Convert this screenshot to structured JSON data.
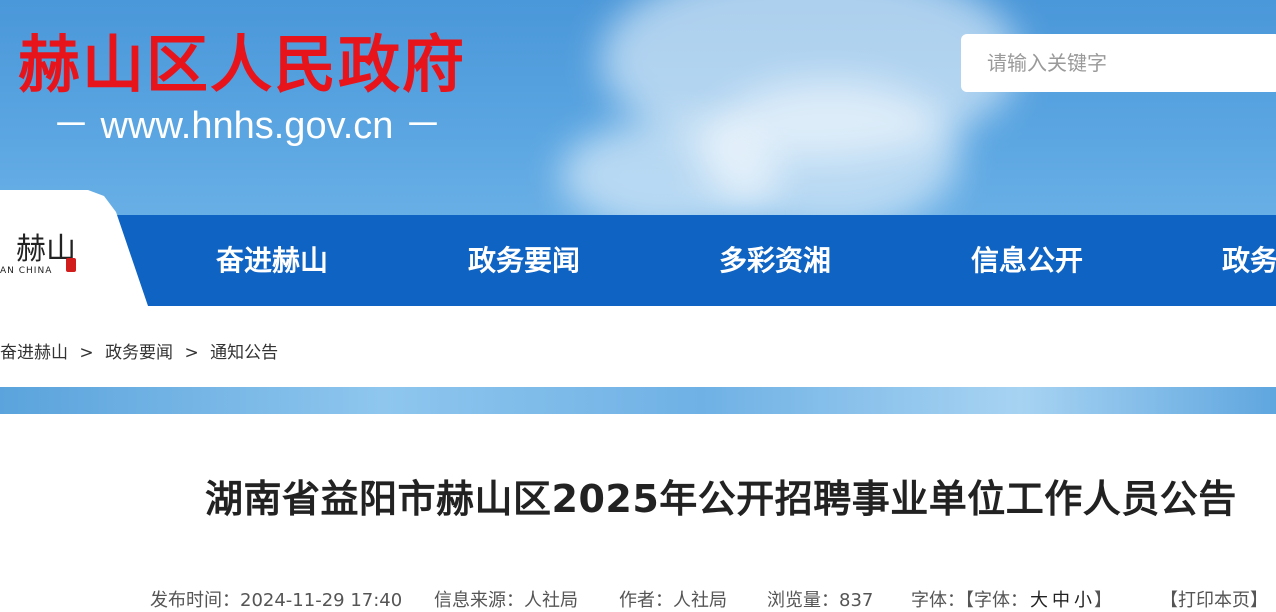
{
  "header": {
    "site_title": "赫山区人民政府",
    "site_url": "－ www.hnhs.gov.cn －",
    "search": {
      "placeholder": "请输入关键字"
    }
  },
  "logo": {
    "mark": "赫山",
    "sub": "AN  CHINA"
  },
  "nav": {
    "items": [
      {
        "label": "奋进赫山"
      },
      {
        "label": "政务要闻"
      },
      {
        "label": "多彩资湘"
      },
      {
        "label": "信息公开"
      },
      {
        "label": "政务"
      }
    ]
  },
  "breadcrumb": {
    "items": [
      "奋进赫山",
      "政务要闻",
      "通知公告"
    ],
    "separator": ">"
  },
  "article": {
    "title": "湖南省益阳市赫山区2025年公开招聘事业单位工作人员公告",
    "meta": {
      "publish_label": "发布时间：",
      "publish_time": "2024-11-29 17:40",
      "source_label": "信息来源：",
      "source": "人社局",
      "author_label": "作者：",
      "author": "人社局",
      "views_label": "浏览量：",
      "views": "837",
      "font_label": "字体：",
      "font_prefix": "【字体：",
      "font_large": "大",
      "font_medium": "中",
      "font_small": "小",
      "font_suffix": "】",
      "print": "【打印本页】"
    }
  },
  "colors": {
    "title_red": "#e8141b",
    "nav_blue": "#0f63c2",
    "sky_blue": "#5ba6e2"
  }
}
